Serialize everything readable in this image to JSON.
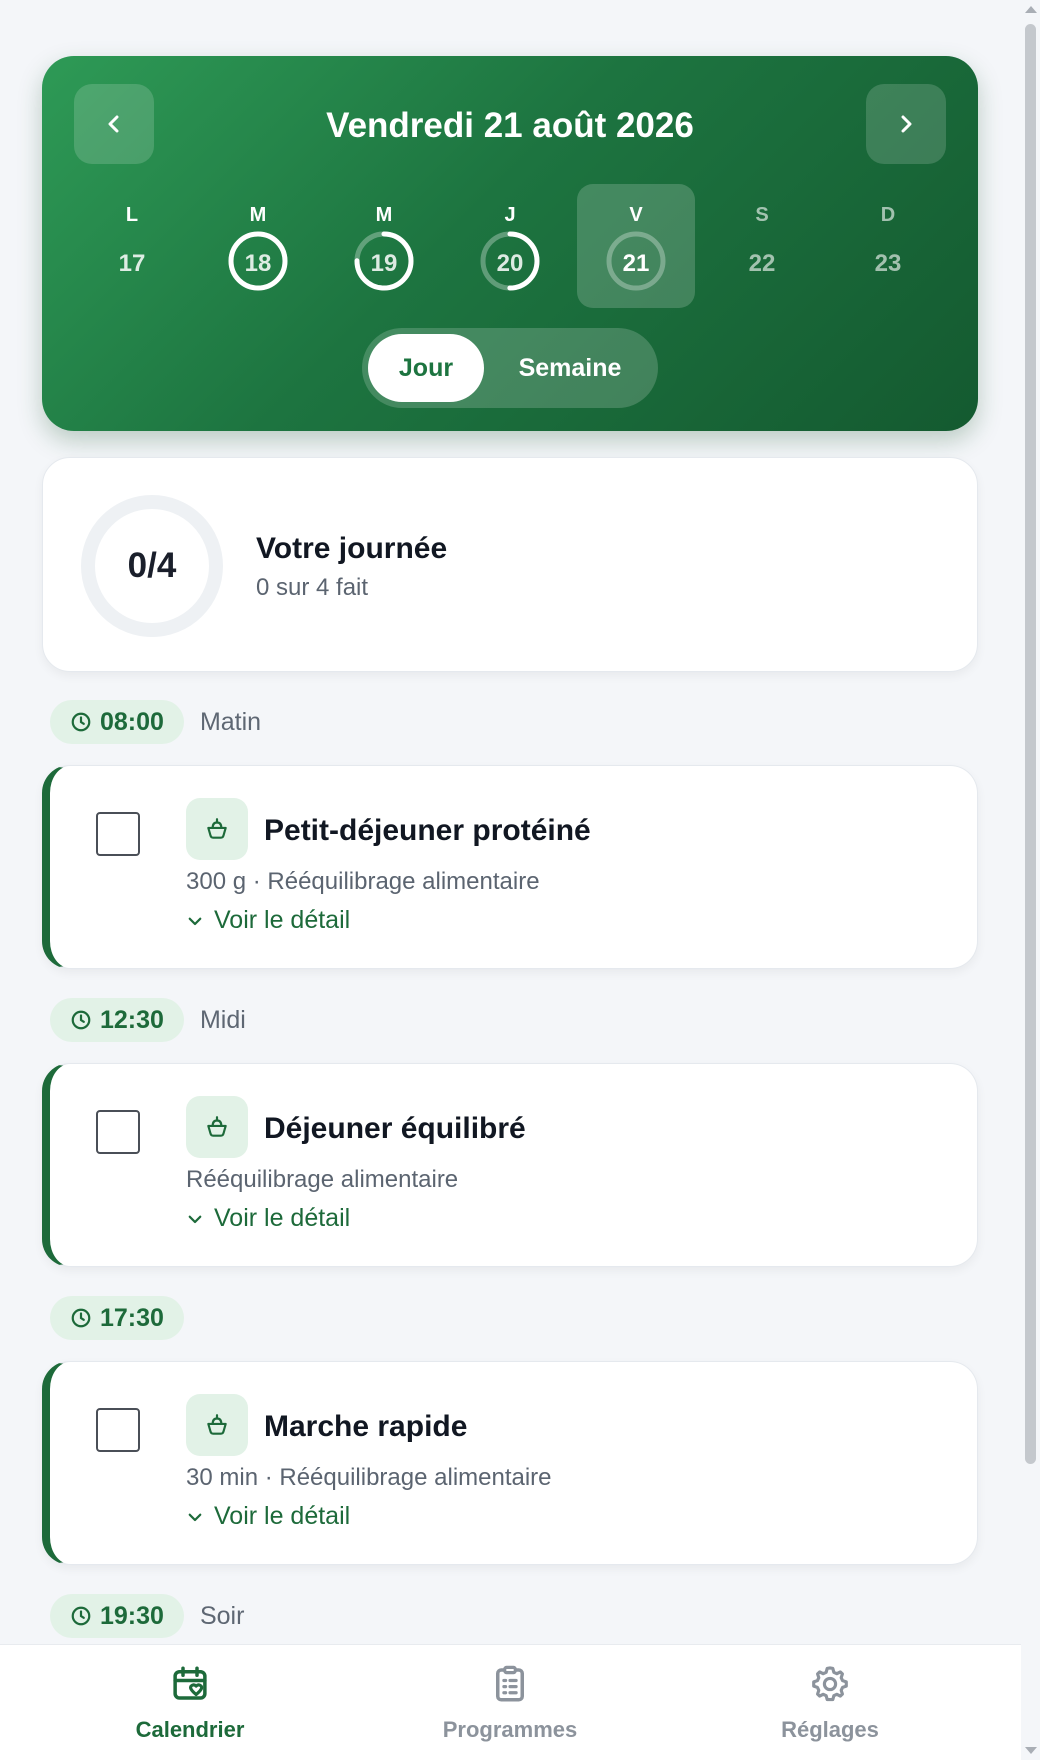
{
  "header": {
    "title": "Vendredi 21 août 2026",
    "week": [
      {
        "letter": "L",
        "number": "17",
        "state": "past",
        "progress": null
      },
      {
        "letter": "M",
        "number": "18",
        "state": "past",
        "progress": 1.0
      },
      {
        "letter": "M",
        "number": "19",
        "state": "past",
        "progress": 0.75
      },
      {
        "letter": "J",
        "number": "20",
        "state": "past",
        "progress": 0.5
      },
      {
        "letter": "V",
        "number": "21",
        "state": "selected",
        "progress": 0.0
      },
      {
        "letter": "S",
        "number": "22",
        "state": "future",
        "progress": null
      },
      {
        "letter": "D",
        "number": "23",
        "state": "future",
        "progress": null
      }
    ],
    "view_toggle": {
      "day": "Jour",
      "week": "Semaine",
      "selected": "Jour"
    }
  },
  "summary": {
    "count": "0/4",
    "title": "Votre journée",
    "subtitle": "0 sur 4 fait",
    "progress": 0
  },
  "schedule": [
    {
      "time": "08:00",
      "period": "Matin",
      "task": {
        "name": "Petit-déjeuner protéiné",
        "meta": "300 g · Rééquilibrage alimentaire",
        "detail": "Voir le détail",
        "done": false,
        "icon": "salad-bowl-icon"
      }
    },
    {
      "time": "12:30",
      "period": "Midi",
      "task": {
        "name": "Déjeuner équilibré",
        "meta": "Rééquilibrage alimentaire",
        "detail": "Voir le détail",
        "done": false,
        "icon": "salad-bowl-icon"
      }
    },
    {
      "time": "17:30",
      "period": "",
      "task": {
        "name": "Marche rapide",
        "meta": "30 min · Rééquilibrage alimentaire",
        "detail": "Voir le détail",
        "done": false,
        "icon": "salad-bowl-icon"
      }
    },
    {
      "time": "19:30",
      "period": "Soir",
      "task": null
    }
  ],
  "bottom_nav": {
    "tabs": [
      {
        "label": "Calendrier",
        "icon": "calendar-heart-icon",
        "active": true
      },
      {
        "label": "Programmes",
        "icon": "clipboard-list-icon",
        "active": false
      },
      {
        "label": "Réglages",
        "icon": "gear-icon",
        "active": false
      }
    ]
  },
  "colors": {
    "accent": "#1d6a3a",
    "accent_light": "#e2f2e7",
    "header_from": "#2e9a56",
    "header_to": "#145a30"
  }
}
